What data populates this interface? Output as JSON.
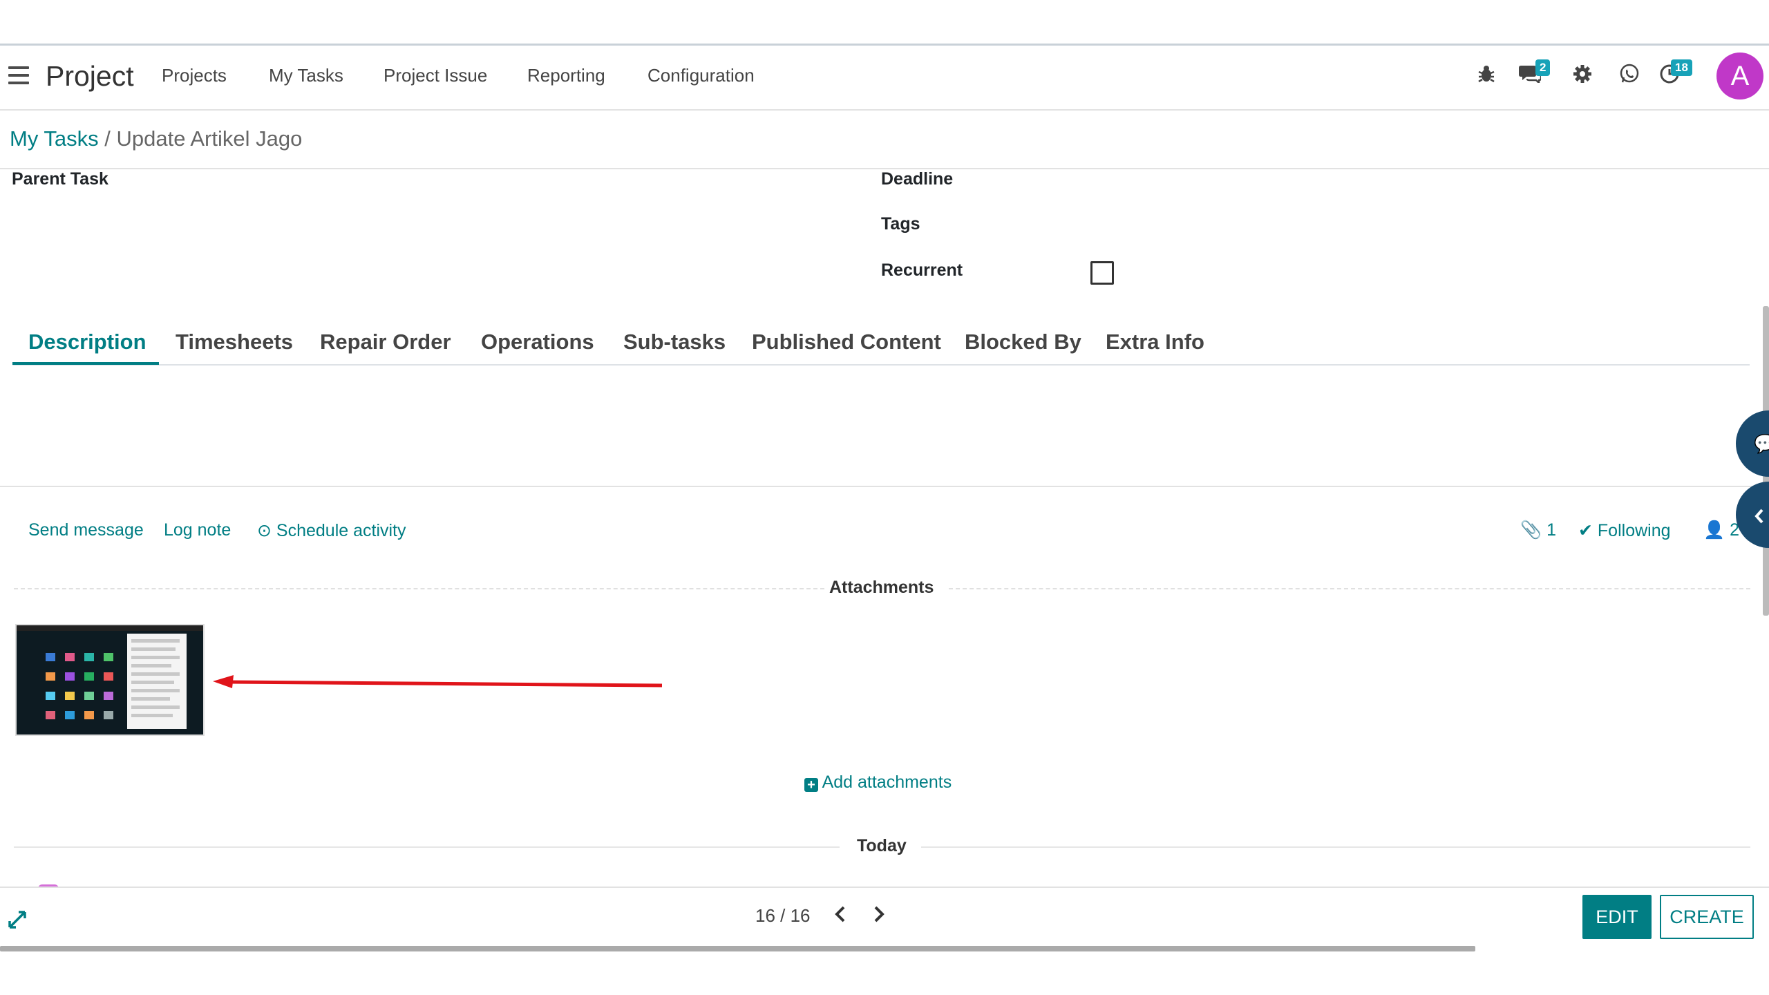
{
  "navbar": {
    "app_title": "Project",
    "menu": [
      "Projects",
      "My Tasks",
      "Project Issue",
      "Reporting",
      "Configuration"
    ],
    "messages_badge": "2",
    "activities_badge": "18",
    "avatar_letter": "A",
    "avatar_color": "#c038c8"
  },
  "breadcrumb": {
    "parent": "My Tasks",
    "separator": "/",
    "current": "Update Artikel Jago"
  },
  "form": {
    "parent_task_label": "Parent Task",
    "deadline_label": "Deadline",
    "tags_label": "Tags",
    "recurrent_label": "Recurrent",
    "recurrent_checked": false
  },
  "tabs": [
    "Description",
    "Timesheets",
    "Repair Order",
    "Operations",
    "Sub-tasks",
    "Published Content",
    "Blocked By",
    "Extra Info"
  ],
  "active_tab": "Description",
  "chatter": {
    "send_message": "Send message",
    "log_note": "Log note",
    "schedule_activity": "Schedule activity",
    "attachment_count": "1",
    "following": "Following",
    "follower_count": "2",
    "attachments_title": "Attachments",
    "add_attachments": "Add attachments",
    "today_label": "Today"
  },
  "footer": {
    "pager": "16 / 16",
    "edit": "EDIT",
    "create": "CREATE"
  },
  "colors": {
    "accent": "#017e84",
    "badge": "#17a2b8",
    "arrow": "#e0141a",
    "side_bubble": "#1a4a6e"
  }
}
